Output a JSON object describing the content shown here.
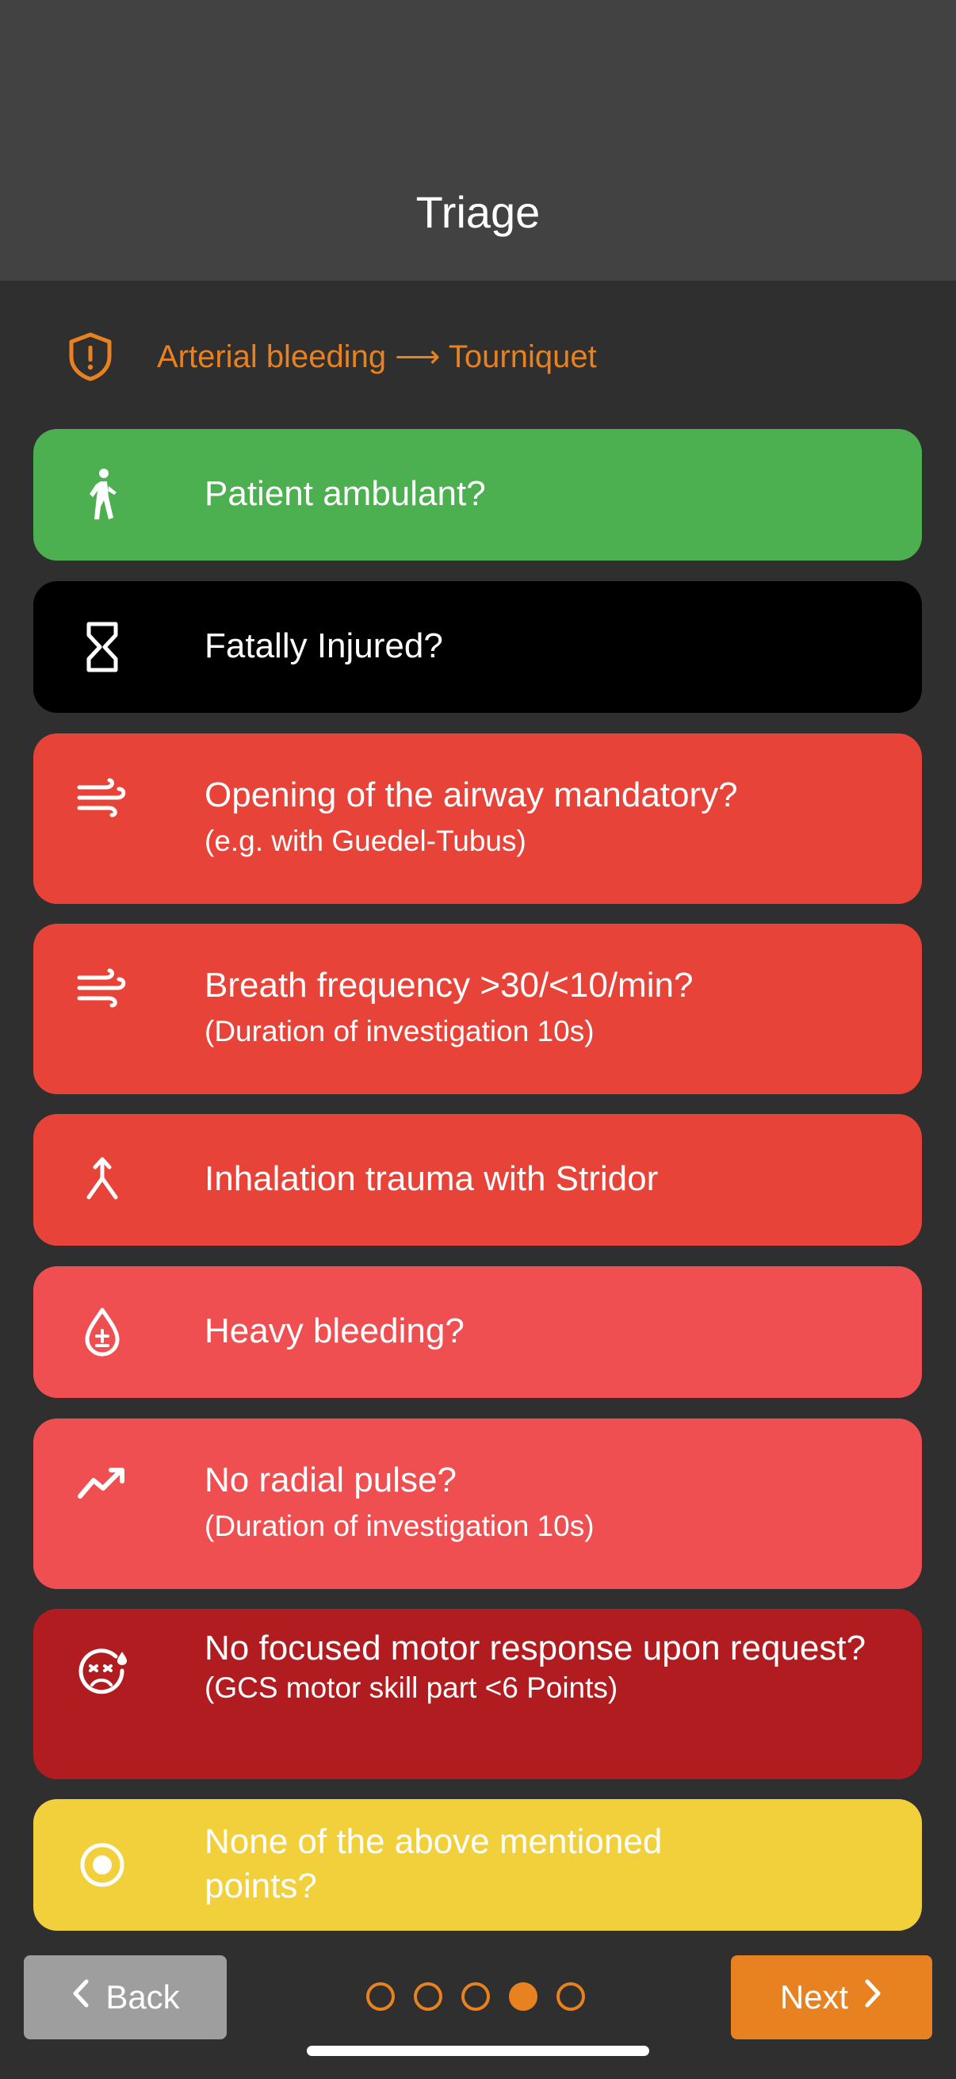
{
  "app": {
    "title": "Triage"
  },
  "notice": {
    "text": "Arterial bleeding ⟶ Tourniquet",
    "icon": "shield-alert-icon",
    "color": "#e8811f"
  },
  "cards": [
    {
      "icon": "walking-person-icon",
      "main": "Patient ambulant?",
      "sub": "",
      "color": "#4caf50"
    },
    {
      "icon": "hourglass-icon",
      "main": "Fatally Injured?",
      "sub": "",
      "color": "#000000"
    },
    {
      "icon": "wind-icon",
      "main": "Opening of the airway mandatory?",
      "sub": "(e.g. with Guedel-Tubus)",
      "color": "#e84338"
    },
    {
      "icon": "wind-icon",
      "main": "Breath frequency >30/<10/min?",
      "sub": "(Duration of investigation 10s)",
      "color": "#e84338"
    },
    {
      "icon": "merge-arrow-icon",
      "main": "Inhalation trauma with Stridor",
      "sub": "",
      "color": "#e84338"
    },
    {
      "icon": "blood-drop-icon",
      "main": "Heavy bleeding?",
      "sub": "",
      "color": "#f04f52"
    },
    {
      "icon": "trending-pulse-icon",
      "main": "No radial pulse?",
      "sub": "(Duration of investigation 10s)",
      "color": "#f04f52"
    },
    {
      "icon": "sick-face-icon",
      "main": "No focused motor response upon request?",
      "sub": "(GCS motor skill part <6 Points)",
      "color": "#b01c1f"
    },
    {
      "icon": "radio-target-icon",
      "main": "None of the above mentioned points?",
      "sub": "",
      "color": "#f2d03b"
    }
  ],
  "nav": {
    "back_label": "Back",
    "next_label": "Next",
    "page_count": 5,
    "current_page": 4
  },
  "colors": {
    "accent": "#e8811f",
    "appbar": "#424242",
    "background": "#2f2f2f"
  }
}
